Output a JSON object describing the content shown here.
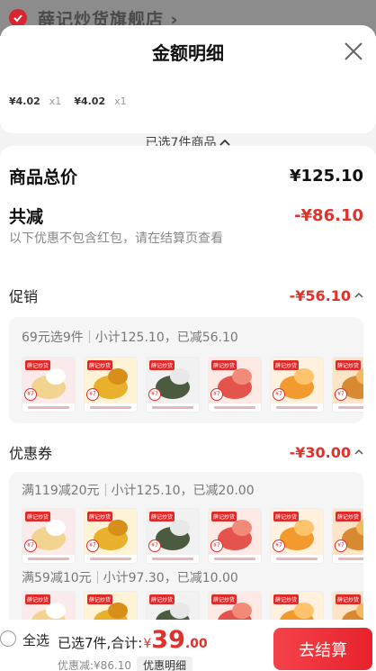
{
  "store": {
    "name": "薛记炒货旗舰店 ›"
  },
  "sheet": {
    "title": "金额明细"
  },
  "selected": {
    "prices": [
      {
        "price": "¥4.02",
        "qty": "x1"
      },
      {
        "price": "¥4.02",
        "qty": "x1"
      }
    ],
    "count_label": "已选7件商品"
  },
  "summary": {
    "total_label": "商品总价",
    "total_value": "¥125.10",
    "reduce_label": "共减",
    "reduce_value": "-¥86.10",
    "note": "以下优惠不包含红包，请在结算页查看"
  },
  "promotion": {
    "label": "促销",
    "value": "-¥56.10",
    "groups": [
      {
        "title": "69元选9件",
        "subtotal": "小计125.10，已减56.10",
        "thumb_count": 6
      }
    ]
  },
  "coupon": {
    "label": "优惠券",
    "value": "-¥30.00",
    "groups": [
      {
        "title": "满119减20元",
        "subtotal": "小计125.10，已减20.00",
        "thumb_count": 6
      },
      {
        "title": "满59减10元",
        "subtotal": "小计97.30，已减10.00",
        "thumb_count": 6
      }
    ]
  },
  "thumb_labels": {
    "tag": "薛记炒货",
    "badge": "¥7",
    "texts": [
      "好爽辣",
      "健康不添加",
      "-10%",
      "无添加",
      "薯片"
    ]
  },
  "bottom": {
    "select_all": "全选",
    "summary_prefix": "已选7件,合计:",
    "currency": "¥",
    "amount_int": "39",
    "amount_dec": ".00",
    "discount": "优惠减:¥86.10",
    "detail_chip": "优惠明细",
    "checkout": "去结算"
  },
  "colors": {
    "accent": "#e0312a",
    "checkout_bg": "#e8222b"
  }
}
